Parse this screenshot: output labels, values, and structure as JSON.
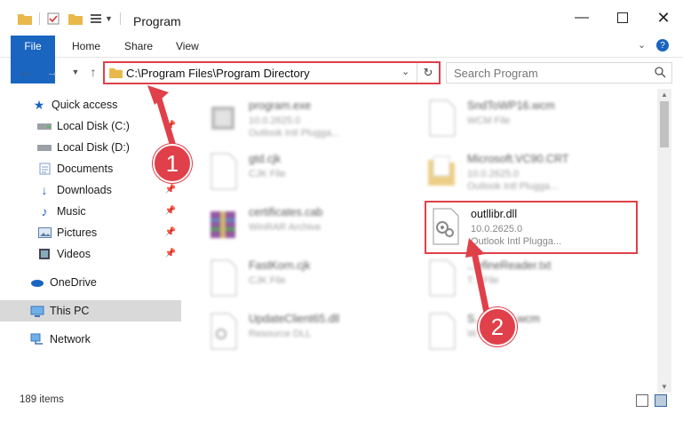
{
  "window": {
    "title": "Program",
    "minimize_icon": "minimize-icon",
    "maximize_icon": "maximize-icon",
    "close_icon": "close-icon"
  },
  "ribbon": {
    "tabs": [
      "File",
      "Home",
      "Share",
      "View"
    ]
  },
  "address_bar": {
    "path": "C:\\Program Files\\Program Directory"
  },
  "search": {
    "placeholder": "Search Program"
  },
  "sidebar": {
    "items": [
      {
        "label": "Quick access",
        "icon": "star-icon"
      },
      {
        "label": "Local Disk (C:)",
        "icon": "drive-icon"
      },
      {
        "label": "Local Disk (D:)",
        "icon": "drive-icon"
      },
      {
        "label": "Documents",
        "icon": "documents-icon"
      },
      {
        "label": "Downloads",
        "icon": "download-icon"
      },
      {
        "label": "Music",
        "icon": "music-icon"
      },
      {
        "label": "Pictures",
        "icon": "pictures-icon"
      },
      {
        "label": "Videos",
        "icon": "videos-icon"
      },
      {
        "label": "OneDrive",
        "icon": "cloud-icon"
      },
      {
        "label": "This PC",
        "icon": "computer-icon"
      },
      {
        "label": "Network",
        "icon": "network-icon"
      }
    ]
  },
  "files": [
    {
      "name": "program.exe",
      "line2": "10.0.2625.0",
      "line3": "Outlook Intl Plugga..."
    },
    {
      "name": "SndToWP16.wcm",
      "line2": "WCM File",
      "line3": ""
    },
    {
      "name": "gtd.cjk",
      "line2": "CJK File",
      "line3": ""
    },
    {
      "name": "Microsoft.VC90.CRT",
      "line2": "10.0.2625.0",
      "line3": "Outlook Intl Plugga..."
    },
    {
      "name": "certificates.cab",
      "line2": "WinRAR Archive",
      "line3": ""
    },
    {
      "name": "outllibr.dll",
      "line2": "10.0.2625.0",
      "line3": "Outlook Intl Plugga..."
    },
    {
      "name": "FastKorn.cjk",
      "line2": "CJK File",
      "line3": ""
    },
    {
      "name": "...efineReader.txt",
      "line2": "T... File",
      "line3": ""
    },
    {
      "name": "UpdateClient65.dll",
      "line2": "Resource DLL",
      "line3": ""
    },
    {
      "name": "S...WP15.wcm",
      "line2": "W...",
      "line3": ""
    }
  ],
  "status": {
    "items_count": "189 items"
  },
  "annotations": {
    "step1": "1",
    "step2": "2",
    "color": "#e0404a"
  }
}
